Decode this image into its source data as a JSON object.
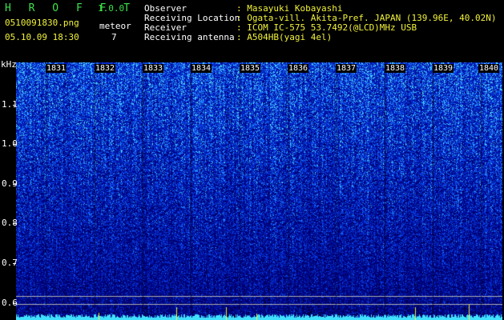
{
  "app": {
    "name": "H R O F F T",
    "version": "1.0.0"
  },
  "file": {
    "name": "0510091830.png",
    "datetime": "05.10.09 18:30"
  },
  "meteor": {
    "label": "meteor",
    "count": "7"
  },
  "info": [
    {
      "label": "Observer",
      "value": ": Masayuki Kobayashi"
    },
    {
      "label": "Receiving Location",
      "value": ": Ogata-vill. Akita-Pref. JAPAN (139.96E, 40.02N)"
    },
    {
      "label": "Receiver",
      "value": ": ICOM IC-575 53.7492(@LCD)MHz USB"
    },
    {
      "label": "Receiving antenna",
      "value": ": A504HB(yagi 4el)"
    }
  ],
  "axis": {
    "unit": "kHz",
    "freq_ticks": [
      "1.1",
      "1.0",
      "0.9",
      "0.8",
      "0.7",
      "0.6"
    ],
    "time_ticks": [
      "1831",
      "1832",
      "1833",
      "1834",
      "1835",
      "1836",
      "1837",
      "1838",
      "1839",
      "1840"
    ]
  },
  "colors": {
    "app_title": "#3ee04a",
    "header_value": "#f2f23a",
    "spectrogram_base": "#00008a",
    "spectrogram_peak": "#40e0ff"
  }
}
